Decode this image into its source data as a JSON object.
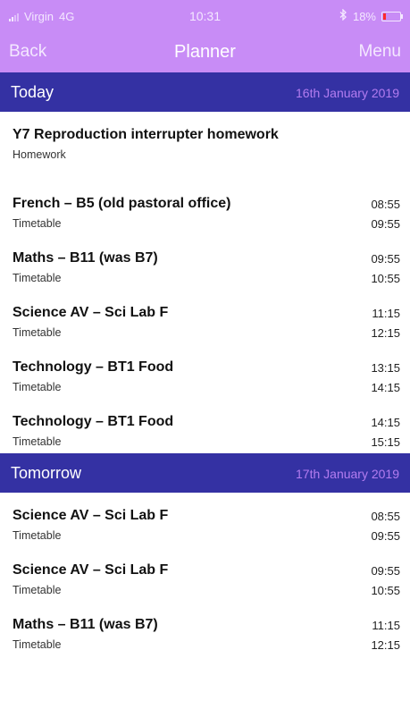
{
  "status_bar": {
    "carrier": "Virgin",
    "network": "4G",
    "time": "10:31",
    "bluetooth_icon": "bluetooth-icon",
    "battery": "18%",
    "battery_level": 0.18,
    "battery_color": "#ff2a2a"
  },
  "nav": {
    "back": "Back",
    "title": "Planner",
    "menu": "Menu"
  },
  "colors": {
    "nav_bg": "#c88cf6",
    "section_bg": "#3431a3",
    "section_date": "#b37cf0"
  },
  "sections": [
    {
      "label": "Today",
      "date": "16th January 2019",
      "items": [
        {
          "name": "Y7 Reproduction interrupter homework",
          "type": "Homework",
          "start": "",
          "end": ""
        },
        {
          "name": "French – B5 (old pastoral office)",
          "type": "Timetable",
          "start": "08:55",
          "end": "09:55"
        },
        {
          "name": "Maths – B11 (was B7)",
          "type": "Timetable",
          "start": "09:55",
          "end": "10:55"
        },
        {
          "name": "Science AV – Sci Lab F",
          "type": "Timetable",
          "start": "11:15",
          "end": "12:15"
        },
        {
          "name": "Technology – BT1 Food",
          "type": "Timetable",
          "start": "13:15",
          "end": "14:15"
        },
        {
          "name": "Technology – BT1 Food",
          "type": "Timetable",
          "start": "14:15",
          "end": "15:15"
        }
      ]
    },
    {
      "label": "Tomorrow",
      "date": "17th January 2019",
      "items": [
        {
          "name": "Science AV – Sci Lab F",
          "type": "Timetable",
          "start": "08:55",
          "end": "09:55"
        },
        {
          "name": "Science AV – Sci Lab F",
          "type": "Timetable",
          "start": "09:55",
          "end": "10:55"
        },
        {
          "name": "Maths – B11 (was B7)",
          "type": "Timetable",
          "start": "11:15",
          "end": "12:15"
        }
      ]
    }
  ]
}
